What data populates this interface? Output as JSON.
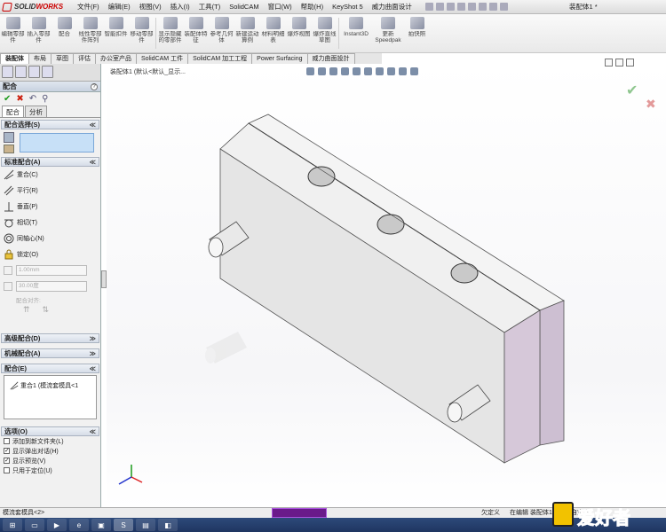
{
  "app": {
    "logo_prefix": "3S",
    "logo_text_a": "SOLID",
    "logo_text_b": "WORKS",
    "doc_title": "装配体1 *"
  },
  "menu": [
    "文件(F)",
    "编辑(E)",
    "视图(V)",
    "插入(I)",
    "工具(T)",
    "SolidCAM",
    "窗口(W)",
    "帮助(H)",
    "KeyShot 5",
    "威力曲面设计"
  ],
  "ribbon": [
    {
      "label": "编辑零部件",
      "icon": "edit-component-icon"
    },
    {
      "label": "插入零部件",
      "icon": "insert-component-icon"
    },
    {
      "label": "配合",
      "icon": "mate-icon"
    },
    {
      "label": "线性零部件阵列",
      "icon": "linear-pattern-icon"
    },
    {
      "label": "智能扣件",
      "icon": "smart-fastener-icon"
    },
    {
      "label": "移动零部件",
      "icon": "move-component-icon"
    },
    {
      "label": "显示隐藏的零部件",
      "icon": "show-hidden-icon"
    },
    {
      "label": "装配体特征",
      "icon": "assembly-feature-icon"
    },
    {
      "label": "参考几何体",
      "icon": "reference-geometry-icon"
    },
    {
      "label": "新建运动算例",
      "icon": "motion-study-icon"
    },
    {
      "label": "材料明细表",
      "icon": "bom-icon"
    },
    {
      "label": "爆炸视图",
      "icon": "exploded-view-icon"
    },
    {
      "label": "爆炸直线草图",
      "icon": "explode-line-icon"
    },
    {
      "label": "Instant3D",
      "icon": "instant3d-icon"
    },
    {
      "label": "更新Speedpak",
      "icon": "speedpak-icon"
    },
    {
      "label": "拍快照",
      "icon": "snapshot-icon"
    }
  ],
  "cm_tabs": [
    "装配体",
    "布局",
    "草图",
    "评估",
    "办公室产品",
    "SolidCAM 工件",
    "SolidCAM 加工工程",
    "Power Surfacing",
    "威力曲面設計"
  ],
  "panel": {
    "title": "配合",
    "help": "?",
    "sub_tabs": [
      "配合",
      "分析"
    ],
    "groups": {
      "selection": "配合选择(S)",
      "standard": "标准配合(A)",
      "advanced": "高级配合(D)",
      "mechanical": "机械配合(A)",
      "mates": "配合(E)",
      "options": "选项(O)"
    },
    "standard_mates": [
      "重合(C)",
      "平行(R)",
      "垂直(P)",
      "相切(T)",
      "同轴心(N)",
      "锁定(O)"
    ],
    "distance": "1.00mm",
    "angle": "30.00度",
    "mate_align": "配合对齐:",
    "mate_item": "重合1 (模流套模具<1",
    "options": [
      {
        "label": "添加到新文件夹(L)",
        "checked": false
      },
      {
        "label": "显示弹出对话(H)",
        "checked": true
      },
      {
        "label": "显示预览(V)",
        "checked": true
      },
      {
        "label": "只用于定位(U)",
        "checked": false
      }
    ]
  },
  "viewport": {
    "tree_crumb": "装配体1  (默认<默认_显示..."
  },
  "status": {
    "left": "模流套模具<2>",
    "s2": "欠定义",
    "s3": "在编辑 装配体1",
    "s4": "自定义"
  },
  "watermark": "爱好者",
  "colors": {
    "face_top": "#f2f2f2",
    "face_front": "#e6e6e6",
    "face_side": "#cfc0d3",
    "accent": "#c00"
  }
}
